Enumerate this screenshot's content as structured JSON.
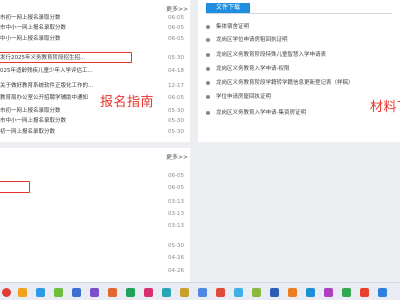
{
  "top_news": {
    "more": "更多>>",
    "items": [
      {
        "title": "市初一网上报名录取分数",
        "date": "06-05"
      },
      {
        "title": "市中小一网上报名录取分数",
        "date": "06-05"
      },
      {
        "title": "中小一网上报名录取分数",
        "date": "06-05"
      },
      {
        "title": "发行2025年义务教育阶段招生招...",
        "date": "05-30"
      },
      {
        "title": "025年适龄残疾儿童少年入学评估工...",
        "date": "04-18"
      },
      {
        "title": "关于做好教育系统软件正版化工作的...",
        "date": "12-17"
      },
      {
        "title": "教育局办公室公开招聘学辅助中通知",
        "date": "06-05"
      },
      {
        "title": "市初一网上报名录取分数",
        "date": "05-30"
      },
      {
        "title": "市中小一网上报名录取分数",
        "date": "05-30"
      },
      {
        "title": "初一网上报名录取分数",
        "date": "05-30"
      }
    ],
    "annotation": "报名指南"
  },
  "files": {
    "tab": "文件下载",
    "items": [
      "集体宿舍证明",
      "龙岗区学位申请房租回执证明",
      "龙岗区义务教育阶段特殊儿童智慧入学申请表",
      "龙岗区义务教育入学申请-权限",
      "龙岗区义务教育阶段学籍转学籍信息更新登记表（样稿）",
      "学位申请房屋回执证明",
      "龙岗区义务教育入学申请-集资房证明"
    ],
    "annotation": "材料下"
  },
  "bottom_news": {
    "more": "更多>>",
    "items": [
      {
        "title": "",
        "date": "06-05"
      },
      {
        "title": "",
        "date": "06-05"
      },
      {
        "title": "",
        "date": "03-13"
      },
      {
        "title": "",
        "date": "03-13"
      },
      {
        "title": "",
        "date": "03-13"
      },
      {
        "title": "",
        "date": "05-30"
      },
      {
        "title": "",
        "date": "04-26"
      },
      {
        "title": "",
        "date": "04-26"
      }
    ]
  }
}
